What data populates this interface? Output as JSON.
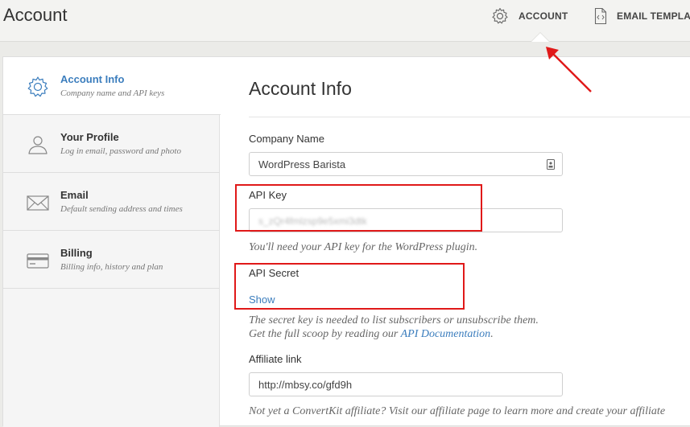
{
  "header": {
    "title": "Account",
    "nav": [
      {
        "label": "ACCOUNT",
        "icon": "gear-icon"
      },
      {
        "label": "EMAIL TEMPLA",
        "icon": "code-file-icon"
      }
    ]
  },
  "sidebar": {
    "items": [
      {
        "title": "Account Info",
        "subtitle": "Company name and API keys",
        "icon": "gear-icon",
        "active": true
      },
      {
        "title": "Your Profile",
        "subtitle": "Log in email, password and photo",
        "icon": "user-icon"
      },
      {
        "title": "Email",
        "subtitle": "Default sending address and times",
        "icon": "envelope-icon"
      },
      {
        "title": "Billing",
        "subtitle": "Billing info, history and plan",
        "icon": "credit-card-icon"
      }
    ]
  },
  "main": {
    "heading": "Account Info",
    "company_name": {
      "label": "Company Name",
      "value": "WordPress Barista"
    },
    "api_key": {
      "label": "API Key",
      "value": "s_zQr4fmlzsp9e5xmi3dtk",
      "help": "You'll need your API key for the WordPress plugin."
    },
    "api_secret": {
      "label": "API Secret",
      "show_link": "Show",
      "help_line1": "The secret key is needed to list subscribers or unsubscribe them.",
      "help_line2_prefix": "Get the full scoop by reading our ",
      "help_line2_link": "API Documentation",
      "help_line2_suffix": "."
    },
    "affiliate": {
      "label": "Affiliate link",
      "value": "http://mbsy.co/gfd9h",
      "help": "Not yet a ConvertKit affiliate? Visit our affiliate page to learn more and create your affiliate"
    }
  },
  "colors": {
    "accent": "#3b7dbd",
    "annotation": "#e01919"
  }
}
